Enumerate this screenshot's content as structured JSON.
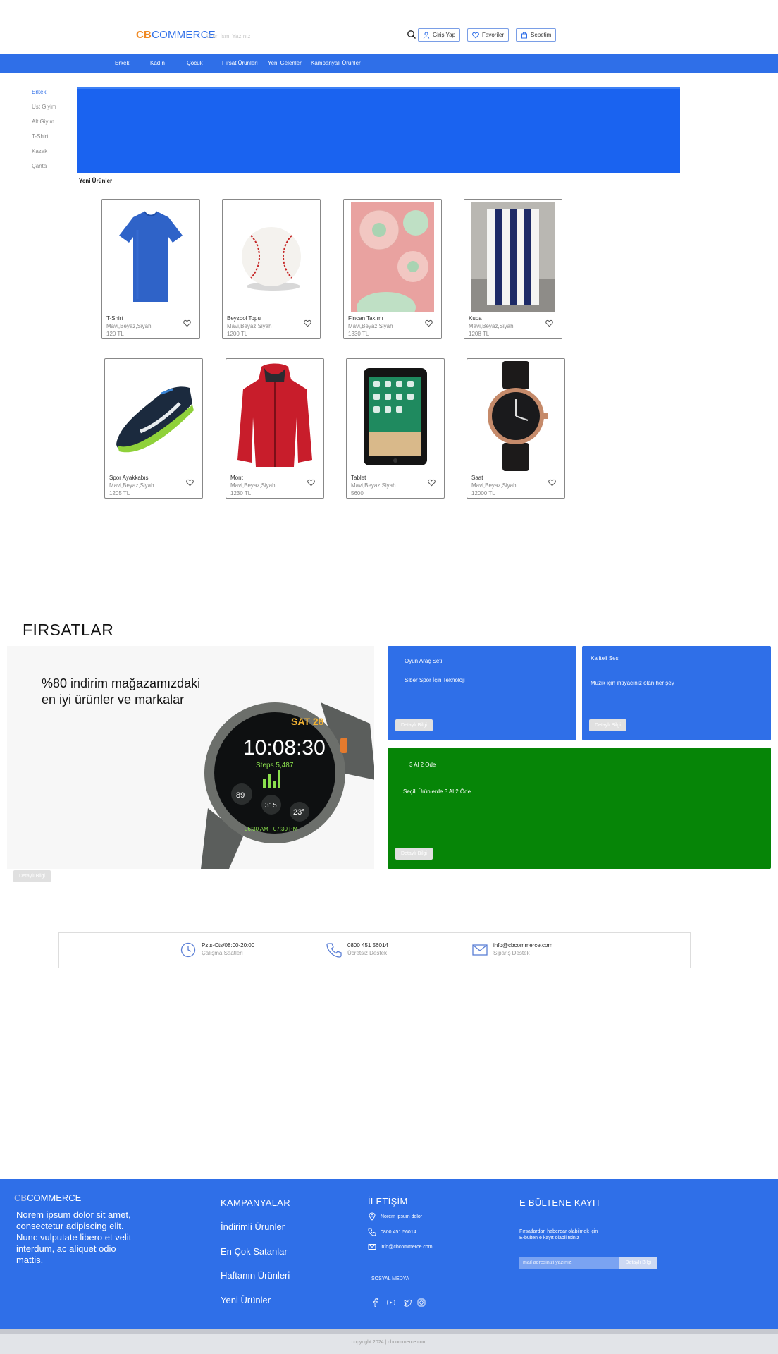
{
  "header": {
    "logo_cb": "CB",
    "logo_rest": "COMMERCE",
    "search_placeholder": "Ürün İsmi Yazınız",
    "login": "Giriş Yap",
    "favorites": "Favoriler",
    "cart": "Sepetim"
  },
  "nav": [
    "Erkek",
    "Kadın",
    "Çocuk",
    "Fırsat Ürünleri",
    "Yeni Gelenler",
    "Kampanyalı Ürünler"
  ],
  "sidebar": [
    "Erkek",
    "Üst Giyim",
    "Alt Giyim",
    "T-Shirt",
    "Kazak",
    "Çanta"
  ],
  "new_products_title": "Yeni Ürünler",
  "products": [
    {
      "name": "T-Shirt",
      "colors": "Mavi,Beyaz,Siyah",
      "price": "120 TL",
      "icon": "tshirt-image"
    },
    {
      "name": "Beyzbol Topu",
      "colors": "Mavi,Beyaz,Siyah",
      "price": "1200 TL",
      "icon": "baseball-image"
    },
    {
      "name": "Fincan Takımı",
      "colors": "Mavi,Beyaz,Siyah",
      "price": "1330 TL",
      "icon": "plates-image"
    },
    {
      "name": "Kupa",
      "colors": "Mavi,Beyaz,Siyah",
      "price": "1208 TL",
      "icon": "mug-image"
    },
    {
      "name": "Spor Ayakkabısı",
      "colors": "Mavi,Beyaz,Siyah",
      "price": "1205 TL",
      "icon": "sneaker-image"
    },
    {
      "name": "Mont",
      "colors": "Mavi,Beyaz,Siyah",
      "price": "1230 TL",
      "icon": "jacket-image"
    },
    {
      "name": "Tablet",
      "colors": "Mavi,Beyaz,Siyah",
      "price": "5600",
      "icon": "tablet-image"
    },
    {
      "name": "Saat",
      "colors": "Mavi,Beyaz,Siyah",
      "price": "12000 TL",
      "icon": "watch-image"
    }
  ],
  "firsatlar": {
    "title": "FIRSATLAR",
    "main_text_1": "%80 indirim mağazamızdaki",
    "main_text_2": "en iyi ürünler ve markalar",
    "main_button": "Detaylı Bilgi",
    "smartwatch": {
      "date": "SAT 28",
      "time": "10:08:30",
      "steps": "Steps 5,487",
      "battery": "89",
      "temp": "23°",
      "value": "315",
      "footer": "06:30 AM · 07:30 PM"
    },
    "box1": {
      "title": "Oyun Araç Seti",
      "subtitle": "Siber Spor İçin Teknoloji",
      "button": "Detaylı Bilgi",
      "color": "#2f6fe8"
    },
    "box2": {
      "title": "Kaliteli Ses",
      "subtitle": "Müzik için ihtiyacınız olan her şey",
      "button": "Detaylı Bilgi",
      "color": "#2f6fe8"
    },
    "box3": {
      "title": "3 Al 2 Öde",
      "subtitle": "Seçili Ürünlerde 3 Al 2 Öde",
      "button": "Detaylı Bilgi",
      "color": "#068507"
    }
  },
  "info": [
    {
      "line1": "Pzts-Cts/08:00-20:00",
      "line2": "Çalışma Saatleri",
      "icon": "clock-icon"
    },
    {
      "line1": "0800 451 56014",
      "line2": "Ücretsiz Destek",
      "icon": "phone-icon"
    },
    {
      "line1": "info@cbcommerce.com",
      "line2": "Sipariş Destek",
      "icon": "mail-icon"
    }
  ],
  "footer": {
    "logo_cb": "CB",
    "logo_rest": "COMMERCE",
    "description": "Norem ipsum dolor sit amet, consectetur adipiscing elit. Nunc vulputate libero et velit interdum, ac aliquet odio mattis.",
    "campaigns_title": "KAMPANYALAR",
    "campaigns": [
      "İndirimli Ürünler",
      "En Çok Satanlar",
      "Haftanın Ürünleri",
      "Yeni Ürünler"
    ],
    "contact_title": "İLETİŞİM",
    "address": "Norem ipsum dolor",
    "phone": "0800 451 56014",
    "email": "info@cbcommerce.com",
    "social_title": "SOSYAL MEDYA",
    "newsletter_title": "E BÜLTENE KAYIT",
    "newsletter_text_1": "Fırsatlardan haberdar olabilmek için",
    "newsletter_text_2": "E-bülten e kayıt olabilirsiniz",
    "newsletter_placeholder": "mail adresinizi yazınız",
    "newsletter_button": "Detaylı Bilgi",
    "copyright": "copyright 2024 | cbcommerce.com"
  }
}
